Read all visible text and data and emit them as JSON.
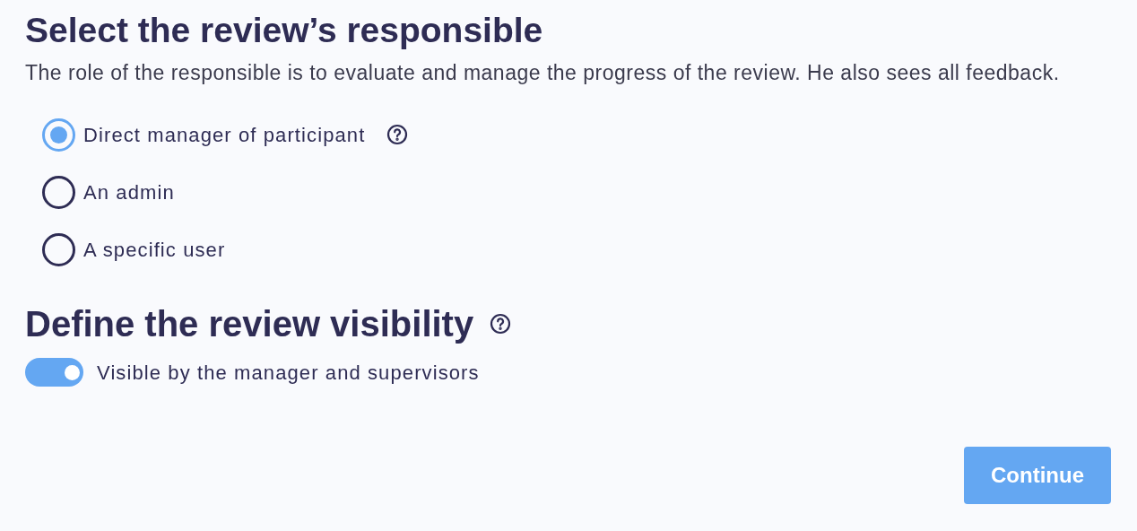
{
  "responsible": {
    "title": "Select the review’s responsible",
    "description": "The role of the responsible is to evaluate and manage the progress of the review. He also sees all feedback.",
    "options": [
      {
        "label": "Direct manager of participant",
        "selected": true,
        "help": true
      },
      {
        "label": "An admin",
        "selected": false,
        "help": false
      },
      {
        "label": "A specific user",
        "selected": false,
        "help": false
      }
    ]
  },
  "visibility": {
    "title": "Define the review visibility",
    "help": true,
    "toggle": {
      "label": "Visible by the manager and supervisors",
      "on": true
    }
  },
  "button": {
    "label": "Continue"
  }
}
